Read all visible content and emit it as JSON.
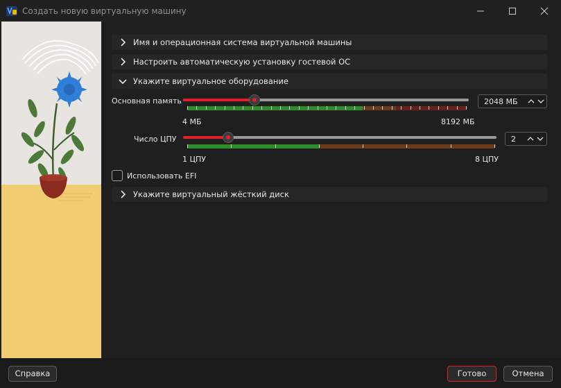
{
  "window": {
    "title": "Создать новую виртуальную машину"
  },
  "sections": [
    {
      "label": "Имя и операционная система виртуальной машины",
      "expanded": false
    },
    {
      "label": "Настроить автоматическую установку гостевой ОС",
      "expanded": false
    },
    {
      "label": "Укажите виртуальное оборудование",
      "expanded": true
    },
    {
      "label": "Укажите виртуальный жёсткий диск",
      "expanded": false
    }
  ],
  "hardware": {
    "memory": {
      "label": "Основная память",
      "value": "2048 МБ",
      "min_label": "4 МБ",
      "max_label": "8192 МБ",
      "fraction": 0.25
    },
    "cpu": {
      "label": "Число ЦПУ",
      "value": "2",
      "min_label": "1 ЦПУ",
      "max_label": "8 ЦПУ",
      "fraction": 0.143
    },
    "efi": {
      "label": "Использовать EFI",
      "checked": false
    }
  },
  "buttons": {
    "help": "Справка",
    "done": "Готово",
    "cancel": "Отмена"
  },
  "colors": {
    "accent": "#e2202a",
    "background": "#1f1f1f",
    "section_bg": "#262626",
    "zone_green": "#2f8a2a",
    "zone_brown": "#6b3b1c",
    "zone_red": "#6a1f1f"
  }
}
